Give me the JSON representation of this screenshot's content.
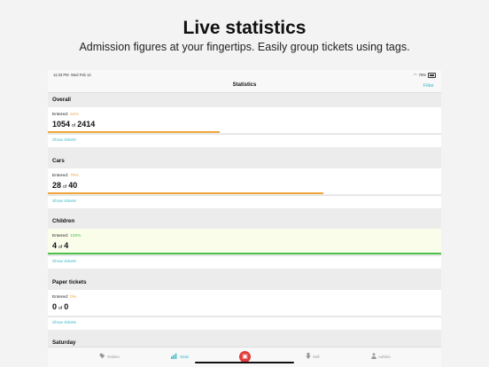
{
  "hero": {
    "title": "Live statistics",
    "subtitle": "Admission figures at your fingertips. Easily group tickets using tags."
  },
  "status": {
    "time": "11:33 PM",
    "date": "Wed Feb 12",
    "battery": "79%"
  },
  "nav": {
    "title": "Statistics",
    "filter": "Filter"
  },
  "entered_label": "Entered:",
  "of_label": "of",
  "show_tickets": "Show tickets",
  "sections": [
    {
      "title": "Overall",
      "percent": "44%",
      "entered": "1054",
      "total": "2414",
      "fill": 0.44,
      "color": "#f0a53a"
    },
    {
      "title": "Cars",
      "percent": "70%",
      "entered": "28",
      "total": "40",
      "fill": 0.7,
      "color": "#f0a53a"
    },
    {
      "title": "Children",
      "percent": "100%",
      "entered": "4",
      "total": "4",
      "fill": 1.0,
      "color": "#4cc04c"
    },
    {
      "title": "Paper tickets",
      "percent": "0%",
      "entered": "0",
      "total": "0",
      "fill": 0.0,
      "color": "#f0a53a"
    }
  ],
  "next_section": "Saturday",
  "tabs": [
    {
      "label": "Orders",
      "icon": "tag-icon"
    },
    {
      "label": "Stats",
      "icon": "chart-icon"
    },
    {
      "label": "",
      "icon": "scan-icon"
    },
    {
      "label": "Sell",
      "icon": "download-icon"
    },
    {
      "label": "Admits",
      "icon": "person-icon"
    }
  ]
}
